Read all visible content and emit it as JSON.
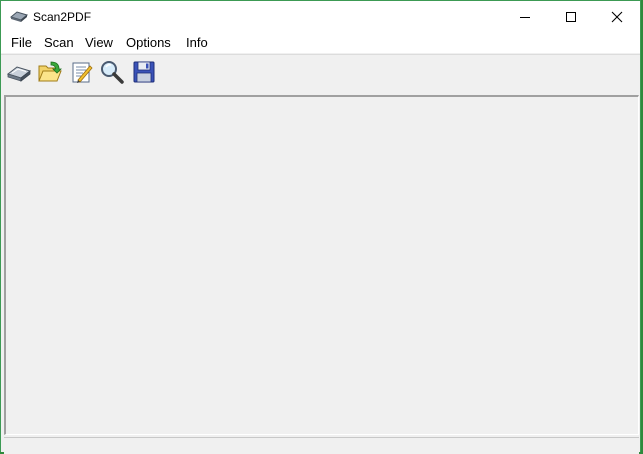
{
  "window": {
    "title": "Scan2PDF",
    "controls": {
      "minimize": "minimize",
      "maximize": "maximize",
      "close": "close"
    }
  },
  "menu": [
    "File",
    "Scan",
    "View",
    "Options",
    "Info"
  ],
  "toolbar": {
    "buttons": [
      {
        "icon": "scanner-icon"
      },
      {
        "icon": "open-folder-icon"
      },
      {
        "icon": "edit-document-icon"
      },
      {
        "icon": "zoom-icon"
      },
      {
        "icon": "save-disk-icon"
      }
    ]
  },
  "colors": {
    "accent_border": "#3c9a54",
    "client_bg": "#f0f0f0"
  }
}
